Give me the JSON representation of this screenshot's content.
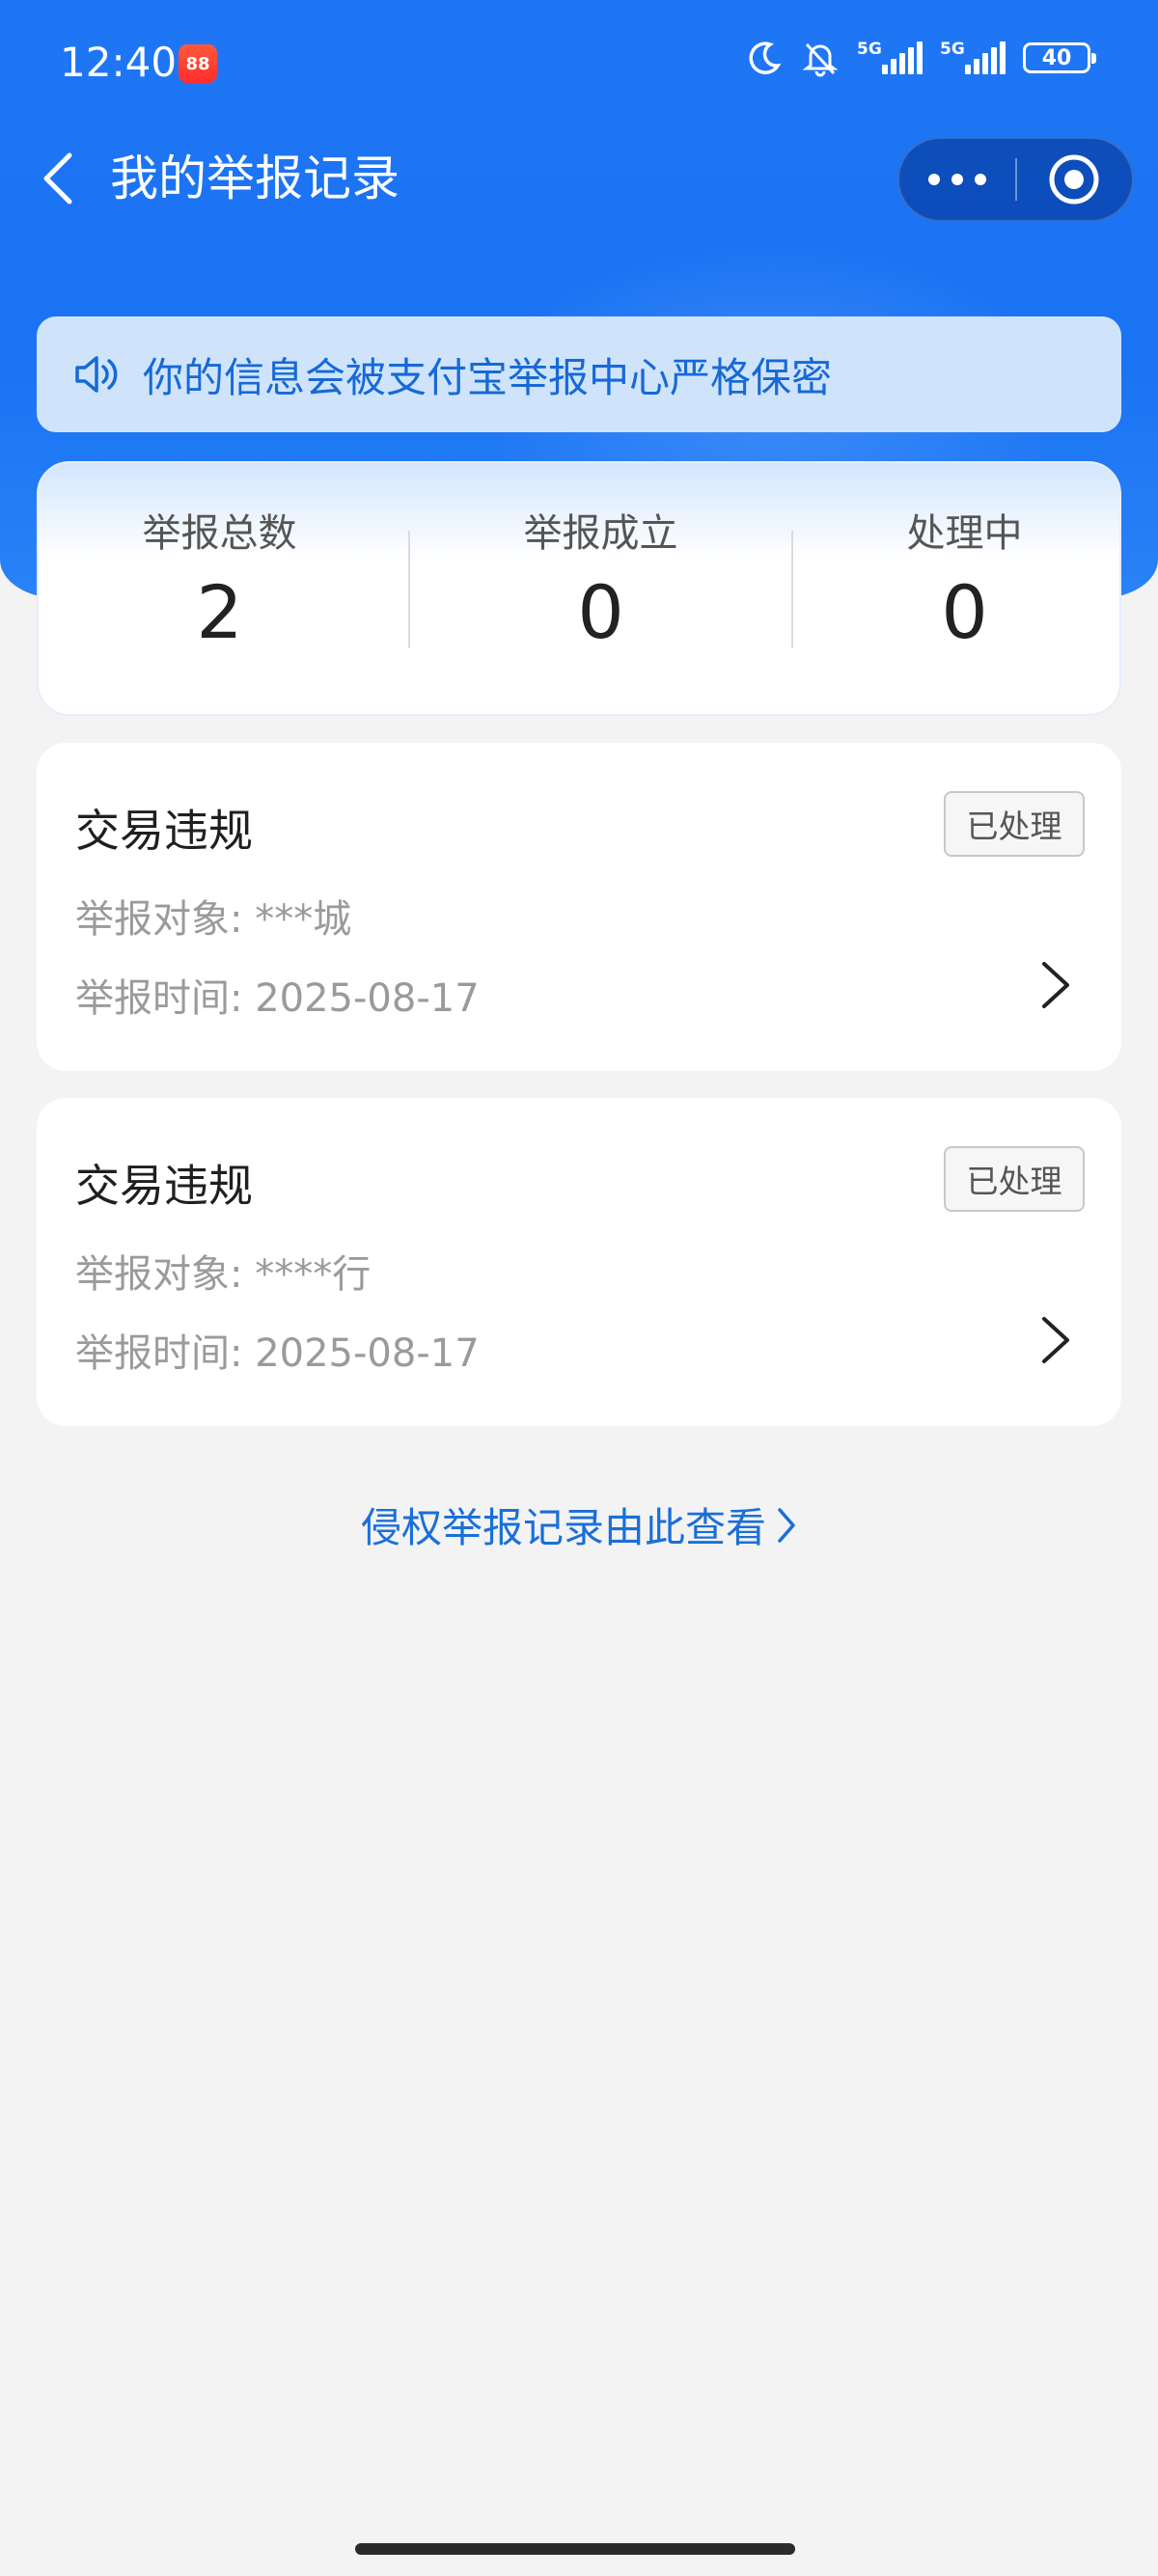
{
  "status_bar": {
    "time": "12:40",
    "app_badge_text": "88",
    "signal1_label": "5G",
    "signal2_label": "5G",
    "battery": "40",
    "icons": [
      "moon-icon",
      "bell-off-icon",
      "signal-icon",
      "signal-icon",
      "battery-icon"
    ]
  },
  "nav": {
    "title": "我的举报记录",
    "back_icon": "chevron-left-icon",
    "more_icon": "more-icon",
    "close_icon": "target-icon"
  },
  "notice": {
    "icon": "speaker-icon",
    "text": "你的信息会被支付宝举报中心严格保密"
  },
  "stats": [
    {
      "label": "举报总数",
      "value": "2"
    },
    {
      "label": "举报成立",
      "value": "0"
    },
    {
      "label": "处理中",
      "value": "0"
    }
  ],
  "records": [
    {
      "title": "交易违规",
      "status": "已处理",
      "target_key": "举报对象:",
      "target_value": "***城",
      "time_key": "举报时间:",
      "time_value": "2025-08-17"
    },
    {
      "title": "交易违规",
      "status": "已处理",
      "target_key": "举报对象:",
      "target_value": "****行",
      "time_key": "举报时间:",
      "time_value": "2025-08-17"
    }
  ],
  "footer_link": "侵权举报记录由此查看",
  "colors": {
    "primary": "#1a73f3",
    "link": "#1a6fd9",
    "notice_bg": "#cfe4fb",
    "page_bg": "#f3f3f3"
  }
}
